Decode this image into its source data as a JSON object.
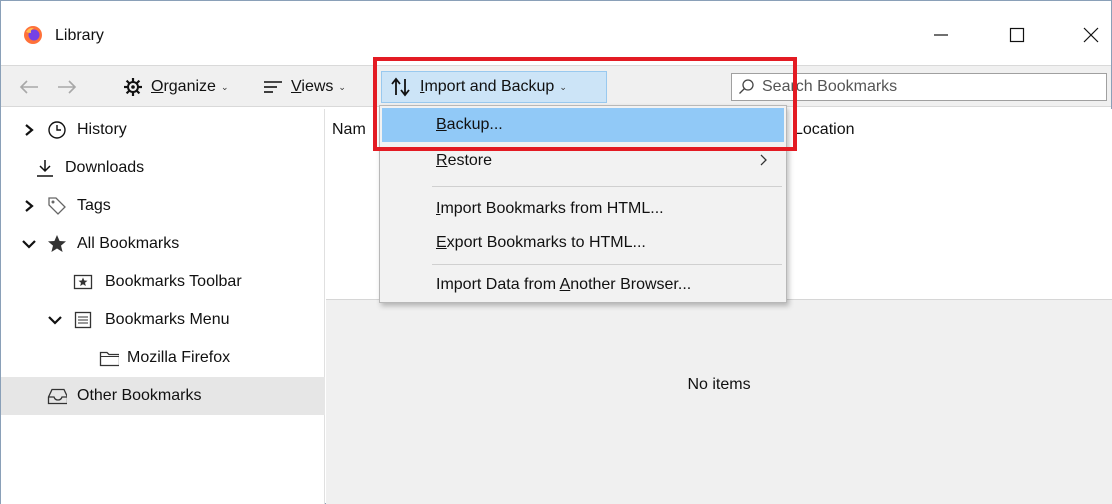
{
  "window": {
    "title": "Library",
    "minimize_label": "Minimize",
    "maximize_label": "Maximize",
    "close_label": "Close"
  },
  "toolbar": {
    "organize": {
      "pre": "",
      "u": "O",
      "post": "rganize"
    },
    "views": {
      "pre": "",
      "u": "V",
      "post": "iews"
    },
    "import_backup": {
      "pre": "",
      "u": "I",
      "post": "mport and Backup"
    }
  },
  "search": {
    "placeholder": "Search Bookmarks",
    "value": ""
  },
  "sidebar": {
    "items": [
      {
        "label": "History"
      },
      {
        "label": "Downloads"
      },
      {
        "label": "Tags"
      },
      {
        "label": "All Bookmarks"
      },
      {
        "label": "Bookmarks Toolbar"
      },
      {
        "label": "Bookmarks Menu"
      },
      {
        "label": "Mozilla Firefox"
      },
      {
        "label": "Other Bookmarks"
      }
    ]
  },
  "columns": {
    "name": "Nam",
    "location": "Location"
  },
  "content": {
    "empty_text": "No items"
  },
  "menu": {
    "items": [
      {
        "pre": "",
        "u": "B",
        "post": "ackup..."
      },
      {
        "pre": "",
        "u": "R",
        "post": "estore"
      },
      {
        "pre": "",
        "u": "I",
        "post": "mport Bookmarks from HTML..."
      },
      {
        "pre": "",
        "u": "E",
        "post": "xport Bookmarks to HTML..."
      },
      {
        "pre": "Import Data from ",
        "u": "A",
        "post": "nother Browser..."
      }
    ]
  },
  "colors": {
    "highlight": "#e31b23",
    "menu_active": "#91c9f7",
    "button_active": "#cce4f7",
    "selected_row": "#e6e6e6"
  }
}
